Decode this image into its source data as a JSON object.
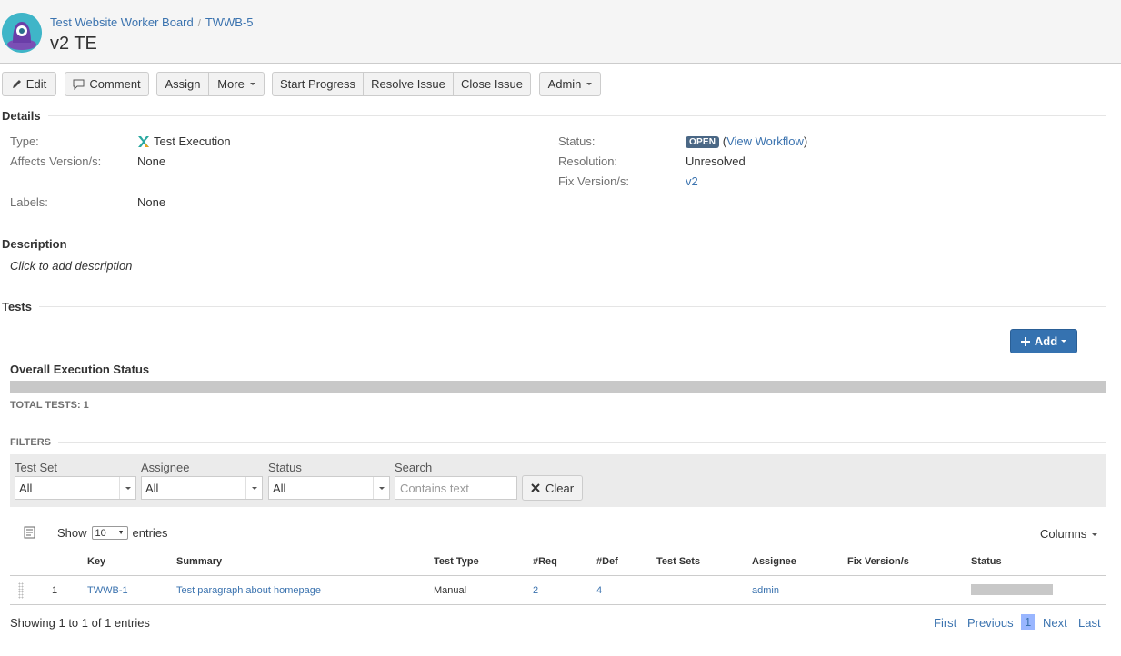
{
  "header": {
    "breadcrumbs": [
      "Test Website Worker Board",
      "TWWB-5"
    ],
    "title": "v2 TE"
  },
  "toolbar": {
    "edit": "Edit",
    "comment": "Comment",
    "assign": "Assign",
    "more": "More",
    "start_progress": "Start Progress",
    "resolve_issue": "Resolve Issue",
    "close_issue": "Close Issue",
    "admin": "Admin"
  },
  "details": {
    "heading": "Details",
    "type_label": "Type:",
    "type_value": "Test Execution",
    "affects_label": "Affects Version/s:",
    "affects_value": "None",
    "labels_label": "Labels:",
    "labels_value": "None",
    "status_label": "Status:",
    "status_value": "OPEN",
    "view_workflow": "View Workflow",
    "resolution_label": "Resolution:",
    "resolution_value": "Unresolved",
    "fix_label": "Fix Version/s:",
    "fix_value": "v2"
  },
  "description": {
    "heading": "Description",
    "placeholder": "Click to add description"
  },
  "tests": {
    "heading": "Tests",
    "add_label": "Add",
    "overall_status": "Overall Execution Status",
    "total_tests": "TOTAL TESTS: 1",
    "filters_heading": "FILTERS",
    "filters": {
      "test_set_label": "Test Set",
      "test_set_value": "All",
      "assignee_label": "Assignee",
      "assignee_value": "All",
      "status_label": "Status",
      "status_value": "All",
      "search_label": "Search",
      "search_placeholder": "Contains text",
      "clear_label": "Clear"
    },
    "show_label": "Show",
    "page_length": "10",
    "entries_label": "entries",
    "columns_label": "Columns",
    "table": {
      "headers": [
        "Key",
        "Summary",
        "Test Type",
        "#Req",
        "#Def",
        "Test Sets",
        "Assignee",
        "Fix Version/s",
        "Status"
      ],
      "rows": [
        {
          "rank": "1",
          "key": "TWWB-1",
          "summary": "Test paragraph about homepage",
          "test_type": "Manual",
          "req": "2",
          "def": "4",
          "test_sets": "",
          "assignee": "admin",
          "fix_version": "",
          "status": ""
        }
      ]
    },
    "showing": "Showing 1 to 1 of 1 entries",
    "pagination": {
      "first": "First",
      "previous": "Previous",
      "current": "1",
      "next": "Next",
      "last": "Last"
    }
  },
  "colors": {
    "primary": "#3572b0",
    "link": "#3b73af",
    "lozenge": "#4a6785",
    "avatar": "#3fb5c8"
  }
}
